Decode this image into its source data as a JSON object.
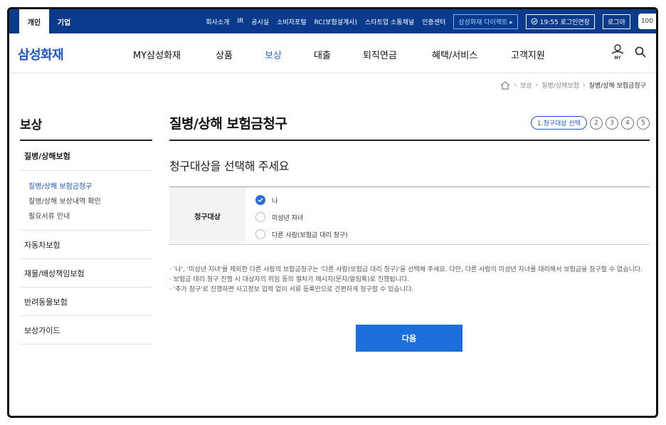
{
  "topbar": {
    "tabs": [
      "개인",
      "기업"
    ],
    "links": [
      "회사소개",
      "IR",
      "공시실",
      "소비자포털",
      "RC(보험설계사)",
      "스타트업 소통채널",
      "인증센터"
    ],
    "direct": "삼성화재 다이렉트 ▸",
    "timer": "19:55 로그인연장",
    "login": "로그아",
    "zoom": "100"
  },
  "gnb": {
    "logo": "삼성화재",
    "menu": [
      "MY삼성화재",
      "상품",
      "보상",
      "대출",
      "퇴직연금",
      "혜택/서비스",
      "고객지원"
    ],
    "active_menu": "보상",
    "my_icon_label": "MY"
  },
  "breadcrumb": [
    "보상",
    "질병/상해보험",
    "질병/상해 보험금청구"
  ],
  "lnb": {
    "title": "보상",
    "group": "질병/상해보험",
    "sub": [
      "질병/상해 보험금청구",
      "질병/상해 보상내역 확인",
      "필요서류 안내"
    ],
    "items": [
      "자동차보험",
      "재물/배상책임보험",
      "반려동물보험",
      "보상가이드"
    ]
  },
  "main": {
    "title": "질병/상해 보험금청구",
    "step_active": "1.청구대상 선택",
    "steps": [
      "2",
      "3",
      "4",
      "5"
    ],
    "subtitle": "청구대상을 선택해 주세요",
    "table_label": "청구대상",
    "options": [
      "나",
      "미성년 자녀",
      "다른 사람(보험금 대리 청구)"
    ],
    "selected_index": 0,
    "notes": [
      "· '나', '미성년 자녀'를 제외한 다른 사람의 보험금청구는 '다른 사람(보험금 대리 청구)'을 선택해 주세요. 다만, 다른 사람의 미성년 자녀를 대리해서 보험금을 청구할 수 없습니다.",
      "· 보험금 대리 청구 진행 시 대상자의 위임 동의 절차가 메시지(문자/알림톡)로 진행됩니다.",
      "· '추가 청구'로 진행하면 사고정보 입력 없이 서류 등록만으로 간편하게 청구할 수 있습니다."
    ],
    "next_label": "다음"
  },
  "colors": {
    "brand": "#0a3a8c",
    "accent": "#1d6fdb",
    "active_text": "#1a56c7"
  }
}
